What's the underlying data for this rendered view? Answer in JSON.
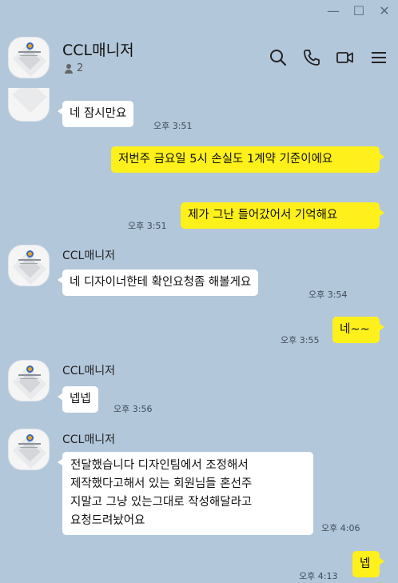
{
  "window": {
    "minimize": "—",
    "maximize": "☐",
    "close": "✕"
  },
  "header": {
    "title": "CCL매니저",
    "member_count": "2"
  },
  "messages": [
    {
      "text": "네 잠시만요",
      "time": "오후 3:51"
    },
    {
      "text": "저번주 금요일 5시 손실도 1계약 기준이에요",
      "time": ""
    },
    {
      "text": "제가 그난 들어갔어서 기억해요",
      "time": "오후 3:51"
    },
    {
      "sender": "CCL매니저",
      "text": "네 디자이너한테 확인요청좀 해볼게요",
      "time": "오후 3:54"
    },
    {
      "text": "네~~",
      "time": "오후 3:55"
    },
    {
      "sender": "CCL매니저",
      "text": "넵넵",
      "time": "오후 3:56"
    },
    {
      "sender": "CCL매니저",
      "lines": [
        "전달했습니다 디자인팀에서 조정해서",
        "제작했다고해서 있는 회원님들 혼선주",
        "지말고 그냥 있는그대로 작성해달라고",
        "요청드려놨어요"
      ],
      "time": "오후 4:06"
    },
    {
      "text": "넵",
      "time": "오후 4:13"
    }
  ]
}
